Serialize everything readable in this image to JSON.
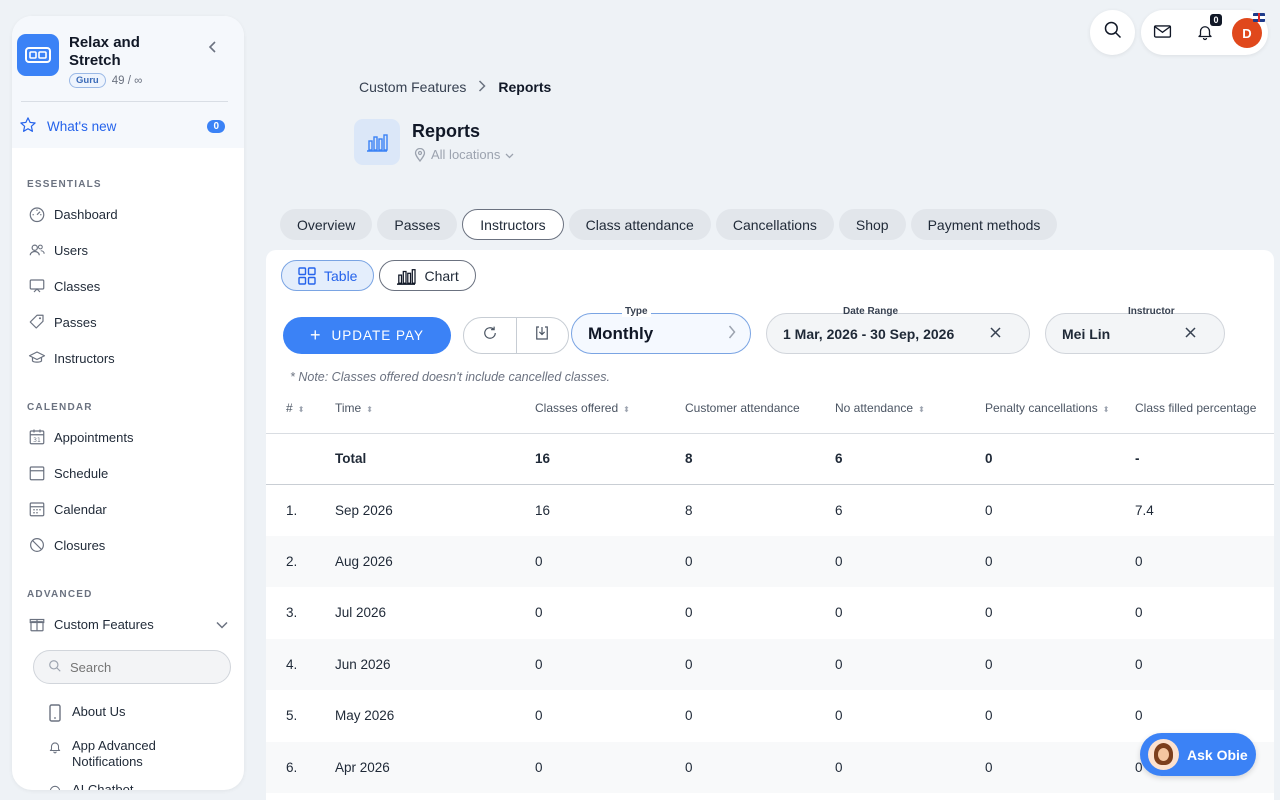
{
  "sidebar": {
    "brand_name": "Relax and Stretch",
    "plan_badge": "Guru",
    "plan_usage": "49 / ∞",
    "whats_new": {
      "label": "What's new",
      "count": "0"
    },
    "sections": {
      "essentials": "ESSENTIALS",
      "calendar": "CALENDAR",
      "advanced": "ADVANCED"
    },
    "essentials_items": [
      "Dashboard",
      "Users",
      "Classes",
      "Passes",
      "Instructors"
    ],
    "calendar_items": [
      "Appointments",
      "Schedule",
      "Calendar",
      "Closures"
    ],
    "advanced_items": [
      "Custom Features"
    ],
    "search_placeholder": "Search",
    "sub_items": [
      "About Us",
      "App Advanced Notifications",
      "AI Chatbot"
    ]
  },
  "topbar": {
    "notification_count": "0",
    "avatar_initial": "D"
  },
  "header": {
    "breadcrumb": [
      "Custom Features",
      "Reports"
    ],
    "title": "Reports",
    "location": "All locations"
  },
  "tabs": [
    "Overview",
    "Passes",
    "Instructors",
    "Class attendance",
    "Cancellations",
    "Shop",
    "Payment methods"
  ],
  "active_tab": "Instructors",
  "view_toggle": {
    "table": "Table",
    "chart": "Chart",
    "active": "Table"
  },
  "controls": {
    "update_pay": "UPDATE PAY",
    "type_label": "Type",
    "type_value": "Monthly",
    "date_label": "Date Range",
    "date_value": "1 Mar, 2026 - 30 Sep, 2026",
    "instructor_label": "Instructor",
    "instructor_value": "Mei Lin"
  },
  "note": "* Note: Classes offered doesn't include cancelled classes.",
  "table": {
    "columns": [
      "#",
      "Time",
      "Classes offered",
      "Customer attendance",
      "No attendance",
      "Penalty cancellations",
      "Class filled percentage"
    ],
    "total": [
      "",
      "Total",
      "16",
      "8",
      "6",
      "0",
      "-"
    ],
    "rows": [
      [
        "1.",
        "Sep 2026",
        "16",
        "8",
        "6",
        "0",
        "7.4"
      ],
      [
        "2.",
        "Aug 2026",
        "0",
        "0",
        "0",
        "0",
        "0"
      ],
      [
        "3.",
        "Jul 2026",
        "0",
        "0",
        "0",
        "0",
        "0"
      ],
      [
        "4.",
        "Jun 2026",
        "0",
        "0",
        "0",
        "0",
        "0"
      ],
      [
        "5.",
        "May 2026",
        "0",
        "0",
        "0",
        "0",
        "0"
      ],
      [
        "6.",
        "Apr 2026",
        "0",
        "0",
        "0",
        "0",
        "0"
      ]
    ]
  },
  "ask_obie": "Ask Obie",
  "colors": {
    "accent": "#3b82f6",
    "avatar": "#e0481c"
  }
}
